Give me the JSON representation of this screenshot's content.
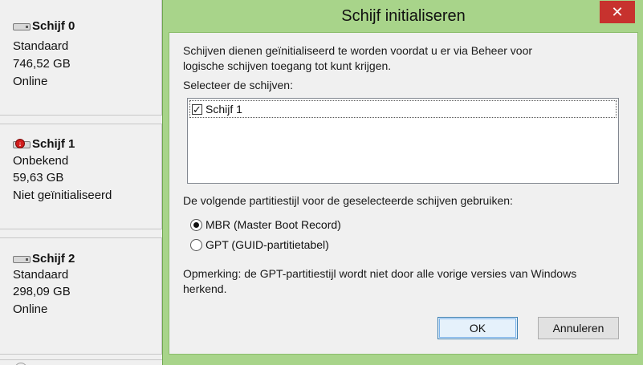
{
  "disks": [
    {
      "name": "Schijf 0",
      "type": "Standaard",
      "size": "746,52 GB",
      "status": "Online",
      "icon": "disk-icon"
    },
    {
      "name": "Schijf 1",
      "type": "Onbekend",
      "size": "59,63 GB",
      "status": "Niet geïnitialiseerd",
      "icon": "disk-error-icon"
    },
    {
      "name": "Schijf 2",
      "type": "Standaard",
      "size": "298,09 GB",
      "status": "Online",
      "icon": "disk-icon"
    }
  ],
  "dialog": {
    "title": "Schijf initialiseren",
    "close_glyph": "✕",
    "intro_line1": "Schijven dienen geïnitialiseerd te worden voordat u er via Beheer voor",
    "intro_line2": "logische schijven toegang tot kunt krijgen.",
    "select_label": "Selecteer de schijven:",
    "disk_list": [
      {
        "label": "Schijf 1",
        "checked": true
      }
    ],
    "partition_label": "De volgende partitiestijl voor de geselecteerde schijven gebruiken:",
    "options": [
      {
        "label": "MBR (Master Boot Record)",
        "selected": true
      },
      {
        "label": "GPT (GUID-partitietabel)",
        "selected": false
      }
    ],
    "note_line1": "Opmerking: de GPT-partitiestijl wordt niet door alle vorige versies van Windows",
    "note_line2": "herkend.",
    "ok_label": "OK",
    "cancel_label": "Annuleren"
  },
  "colors": {
    "dialog_frame": "#a8d48a",
    "close_button": "#c7322e",
    "client_bg": "#f0f0f0"
  }
}
